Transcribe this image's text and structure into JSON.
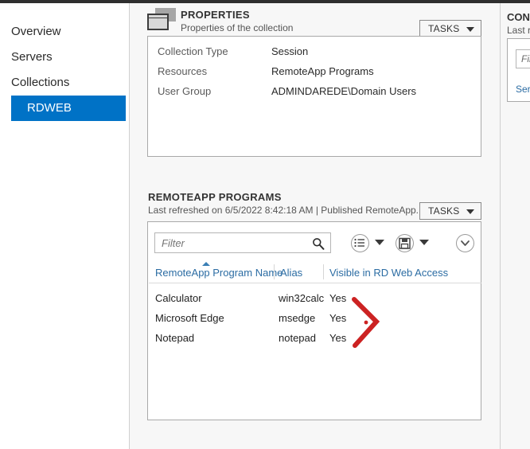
{
  "sidebar": {
    "items": [
      {
        "label": "Overview",
        "selected": false
      },
      {
        "label": "Servers",
        "selected": false
      },
      {
        "label": "Collections",
        "selected": false
      },
      {
        "label": "RDWEB",
        "selected": true
      }
    ]
  },
  "properties": {
    "icon": "window-stack-icon",
    "title": "PROPERTIES",
    "subtitle": "Properties of the collection",
    "tasks_label": "TASKS",
    "rows": [
      {
        "label": "Collection Type",
        "value": "Session"
      },
      {
        "label": "Resources",
        "value": "RemoteApp Programs"
      },
      {
        "label": "User Group",
        "value": "ADMINDAREDE\\Domain Users"
      }
    ]
  },
  "remoteapp": {
    "title": "REMOTEAPP PROGRAMS",
    "subtitle": "Last refreshed on 6/5/2022 8:42:18 AM | Published RemoteApp...",
    "tasks_label": "TASKS",
    "filter_placeholder": "Filter",
    "filter_value": "",
    "toolbar": [
      {
        "icon": "list-view-icon",
        "has_caret": true
      },
      {
        "icon": "save-floppy-icon",
        "has_caret": true
      },
      {
        "icon": "chevron-down-icon",
        "has_caret": false
      }
    ],
    "table": {
      "columns": [
        {
          "label": "RemoteApp Program Name",
          "sorted": true,
          "sort_dir": "asc"
        },
        {
          "label": "Alias",
          "sorted": false
        },
        {
          "label": "Visible in RD Web Access",
          "sorted": false
        }
      ],
      "rows": [
        {
          "name": "Calculator",
          "alias": "win32calc",
          "visible": "Yes"
        },
        {
          "name": "Microsoft Edge",
          "alias": "msedge",
          "visible": "Yes"
        },
        {
          "name": "Notepad",
          "alias": "notepad",
          "visible": "Yes"
        }
      ]
    }
  },
  "annotation": {
    "shape": "red-chevron-arrow",
    "color": "#cc2222"
  },
  "right_panel": {
    "title": "CON",
    "subtitle": "Last r",
    "filter_placeholder": "Fil",
    "link": "Ser"
  },
  "colors": {
    "accent_blue": "#0072c6",
    "header_link_blue": "#2b6ca3",
    "pane_bg": "#f7f7f7",
    "annotation_red": "#cc2222"
  }
}
